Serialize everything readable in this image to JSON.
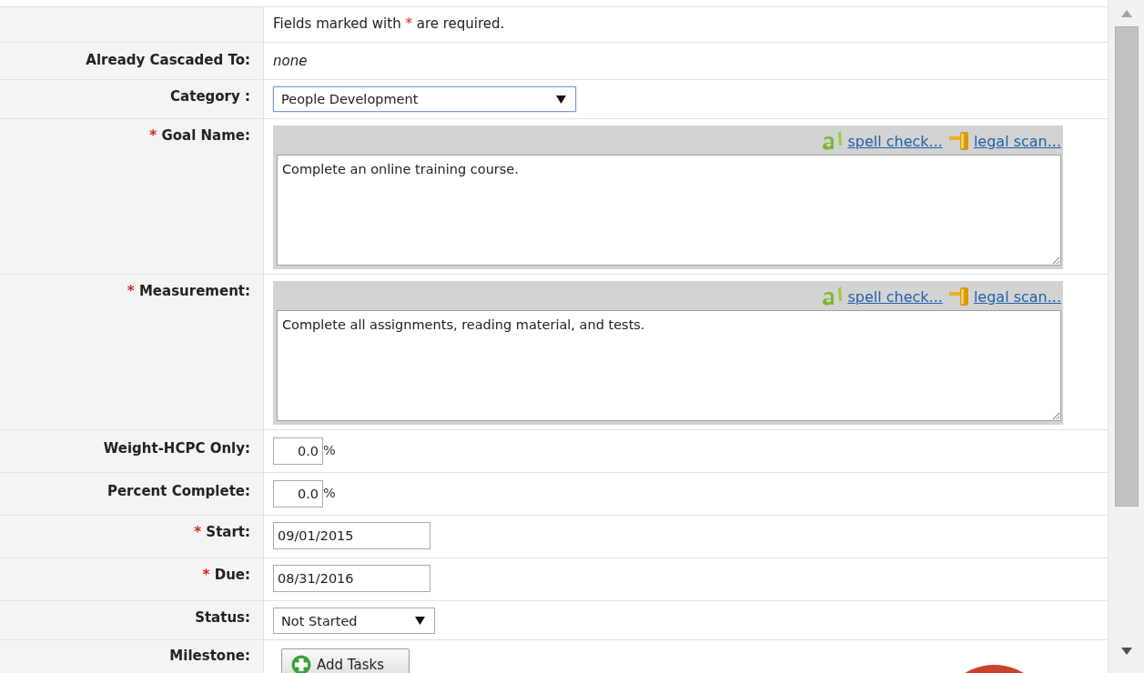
{
  "note": {
    "before": "Fields marked with",
    "mark": "*",
    "after": "are required."
  },
  "rows": [
    {
      "kind": "text",
      "label": "Already Cascaded To:",
      "value": "none"
    },
    {
      "kind": "select",
      "label": "Category :",
      "value": "People Development",
      "focused": true
    },
    {
      "kind": "textarea",
      "label": "Goal Name:",
      "required_mark": "*",
      "value": "Complete an online training course.",
      "tools": [
        {
          "kind": "spell",
          "label": "spell check..."
        },
        {
          "kind": "legal",
          "label": "legal scan..."
        }
      ]
    },
    {
      "kind": "textarea",
      "label": "Measurement:",
      "required_mark": "*",
      "value": "Complete all assignments, reading material, and tests.",
      "tools": [
        {
          "kind": "spell",
          "label": "spell check..."
        },
        {
          "kind": "legal",
          "label": "legal scan..."
        }
      ]
    },
    {
      "kind": "percent",
      "label": "Weight-HCPC Only:",
      "value": "0.0",
      "unit": "%"
    },
    {
      "kind": "percent",
      "label": "Percent Complete:",
      "value": "0.0",
      "unit": "%"
    },
    {
      "kind": "date",
      "label": "Start:",
      "required_mark": "*",
      "value": "09/01/2015"
    },
    {
      "kind": "date",
      "label": "Due:",
      "required_mark": "*",
      "value": "08/31/2016"
    },
    {
      "kind": "select",
      "label": "Status:",
      "value": "Not Started",
      "focused": false
    },
    {
      "kind": "button",
      "label": "Milestone:",
      "value": "Add Tasks"
    }
  ]
}
